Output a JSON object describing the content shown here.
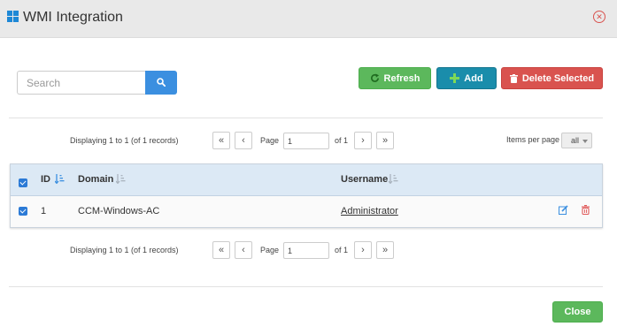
{
  "window": {
    "title": "WMI Integration",
    "icon": "windows-logo-icon",
    "close_icon": "close-circle-icon"
  },
  "search": {
    "placeholder": "Search",
    "value": "",
    "button_icon": "search-icon"
  },
  "toolbar": {
    "refresh_label": "Refresh",
    "add_label": "Add",
    "delete_label": "Delete Selected"
  },
  "pager_top": {
    "display_text": "Displaying 1 to 1 (of 1 records)",
    "first": "«",
    "prev": "‹",
    "page_label": "Page",
    "page_value": "1",
    "of_label": "of 1",
    "next": "›",
    "last": "»"
  },
  "items_per_page": {
    "label": "Items per page",
    "value": "all"
  },
  "table": {
    "columns": [
      {
        "label": "ID"
      },
      {
        "label": "Domain"
      },
      {
        "label": "Username"
      }
    ],
    "rows": [
      {
        "id": "1",
        "domain": "CCM-Windows-AC",
        "username": "Administrator",
        "checked": true
      }
    ],
    "header_checked": true
  },
  "pager_bottom": {
    "display_text": "Displaying 1 to 1 (of 1 records)",
    "first": "«",
    "prev": "‹",
    "page_label": "Page",
    "page_value": "1",
    "of_label": "of 1",
    "next": "›",
    "last": "»"
  },
  "footer": {
    "close_label": "Close"
  },
  "colors": {
    "success": "#5cb85c",
    "info": "#1a8dab",
    "danger": "#d9534f",
    "primary": "#3b8fe0",
    "header_bg": "#dce9f5"
  }
}
